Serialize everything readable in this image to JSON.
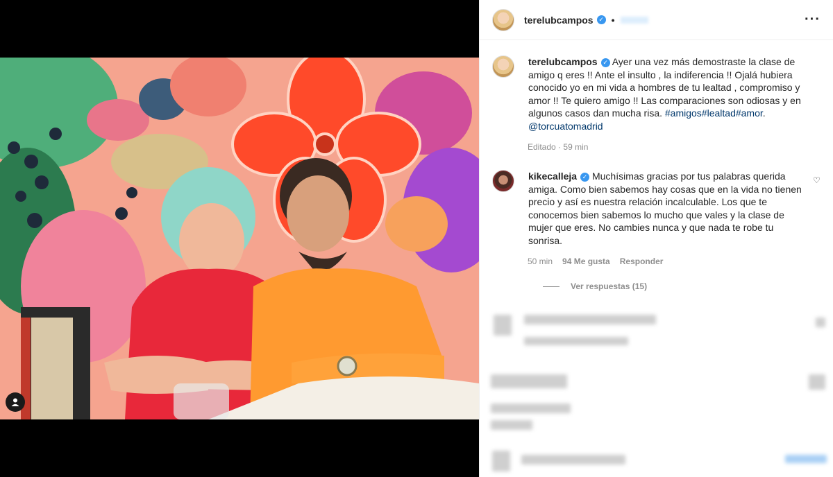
{
  "post": {
    "author": "terelubcampos",
    "dot": "•",
    "more_icon": "more-options-icon",
    "caption_text": "Ayer una vez más demostraste la clase de amigo q eres !! Ante el insulto , la indiferencia !! Ojalá hubiera conocido yo en mi vida a hombres de tu lealtad , compromiso y amor !! Te quiero amigo !! Las comparaciones son odiosas y en algunos casos dan mucha risa. ",
    "hashtags": "#amigos#lealtad#amor",
    "hashtags_after": ".",
    "mention": "@torcuatomadrid",
    "edited": "Editado",
    "edited_dot": "·",
    "time": "59 min"
  },
  "comment": {
    "author": "kikecalleja",
    "text": "Muchísimas gracias por tus palabras querida amiga. Como bien sabemos hay cosas que en la vida no tienen precio y así es nuestra relación incalculable. Los que te conocemos bien sabemos lo mucho que vales y la clase de mujer que eres. No cambies nunca y que nada te robe tu sonrisa.",
    "time": "50 min",
    "likes": "94 Me gusta",
    "reply": "Responder",
    "view_replies": "Ver respuestas (15)"
  },
  "colors": {
    "verified": "#3897f0",
    "link": "#00376b",
    "muted": "#8e8e8e"
  }
}
